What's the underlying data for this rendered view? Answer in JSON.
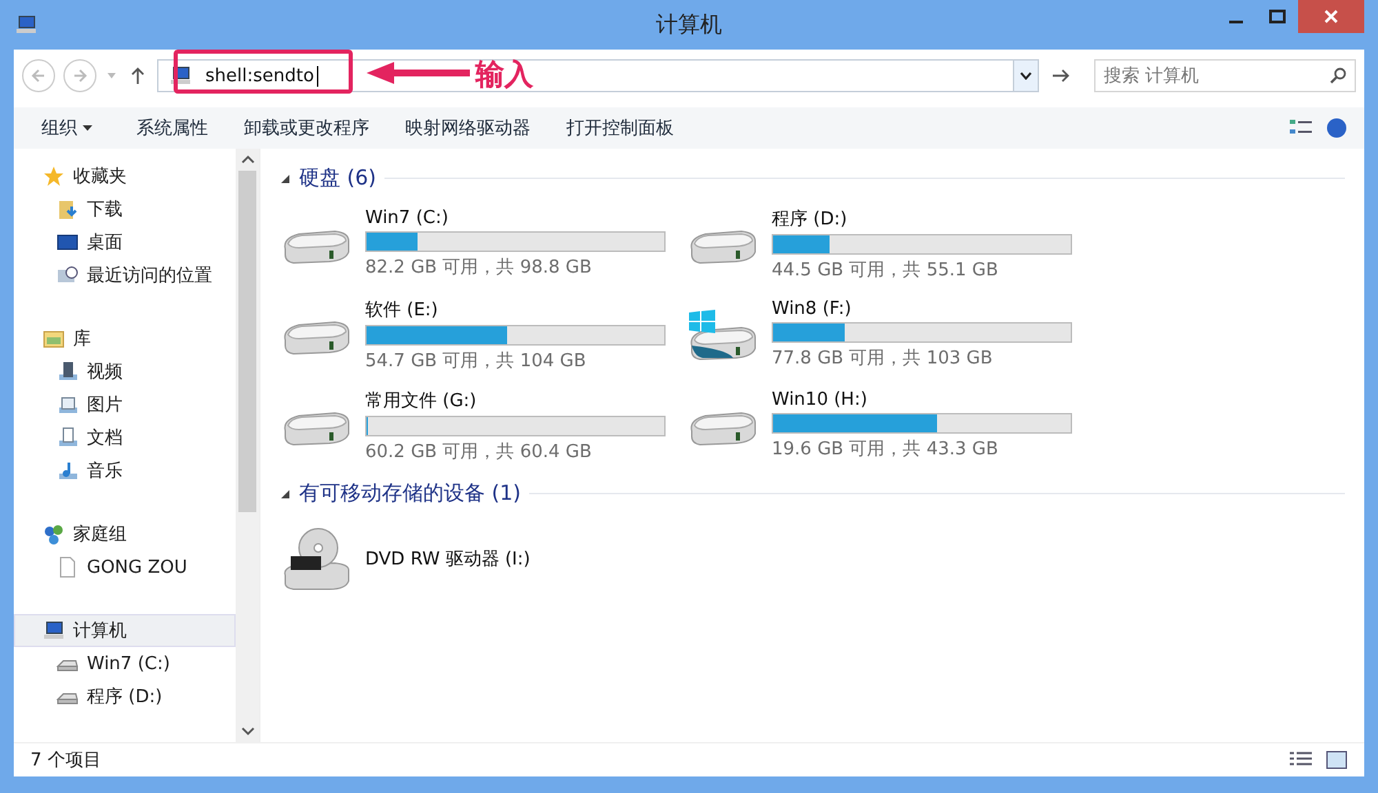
{
  "window": {
    "title": "计算机"
  },
  "address_bar": {
    "value": "shell:sendto"
  },
  "annotation": {
    "label": "输入"
  },
  "search": {
    "placeholder": "搜索 计算机"
  },
  "toolbar": {
    "items": [
      {
        "label": "组织",
        "dropdown": true
      },
      {
        "label": "系统属性",
        "dropdown": false
      },
      {
        "label": "卸载或更改程序",
        "dropdown": false
      },
      {
        "label": "映射网络驱动器",
        "dropdown": false
      },
      {
        "label": "打开控制面板",
        "dropdown": false
      }
    ]
  },
  "sidebar": {
    "groups": [
      {
        "label": "收藏夹",
        "kind": "star",
        "selected": false,
        "children": [
          {
            "label": "下载",
            "kind": "download",
            "selected": false
          },
          {
            "label": "桌面",
            "kind": "desktop",
            "selected": false
          },
          {
            "label": "最近访问的位置",
            "kind": "recent",
            "selected": false
          }
        ]
      },
      {
        "label": "库",
        "kind": "library",
        "selected": false,
        "children": [
          {
            "label": "视频",
            "kind": "video",
            "selected": false
          },
          {
            "label": "图片",
            "kind": "picture",
            "selected": false
          },
          {
            "label": "文档",
            "kind": "document",
            "selected": false
          },
          {
            "label": "音乐",
            "kind": "music",
            "selected": false
          }
        ]
      },
      {
        "label": "家庭组",
        "kind": "homegroup",
        "selected": false,
        "children": [
          {
            "label": "GONG ZOU",
            "kind": "file",
            "selected": false
          }
        ]
      },
      {
        "label": "计算机",
        "kind": "computer",
        "selected": true,
        "children": [
          {
            "label": "Win7 (C:)",
            "kind": "drive",
            "selected": false
          },
          {
            "label": "程序 (D:)",
            "kind": "drive",
            "selected": false
          }
        ]
      }
    ]
  },
  "sections": [
    {
      "title": "硬盘 (6)",
      "expanded": true,
      "drives": [
        {
          "name": "Win7 (C:)",
          "kind": "hdd",
          "level": 0.17,
          "info": "82.2 GB 可用，共 98.8 GB"
        },
        {
          "name": "程序 (D:)",
          "kind": "hdd",
          "level": 0.19,
          "info": "44.5 GB 可用，共 55.1 GB"
        },
        {
          "name": "软件 (E:)",
          "kind": "hdd",
          "level": 0.47,
          "info": "54.7 GB 可用，共 104 GB"
        },
        {
          "name": "Win8 (F:)",
          "kind": "system",
          "level": 0.24,
          "info": "77.8 GB 可用，共 103 GB"
        },
        {
          "name": "常用文件 (G:)",
          "kind": "hdd",
          "level": 0.003,
          "info": "60.2 GB 可用，共 60.4 GB"
        },
        {
          "name": "Win10 (H:)",
          "kind": "hdd",
          "level": 0.55,
          "info": "19.6 GB 可用，共 43.3 GB"
        }
      ]
    },
    {
      "title": "有可移动存储的设备 (1)",
      "expanded": true,
      "drives": [
        {
          "name": "DVD RW 驱动器 (I:)",
          "kind": "dvd"
        }
      ]
    }
  ],
  "status_bar": {
    "text": "7 个项目"
  }
}
